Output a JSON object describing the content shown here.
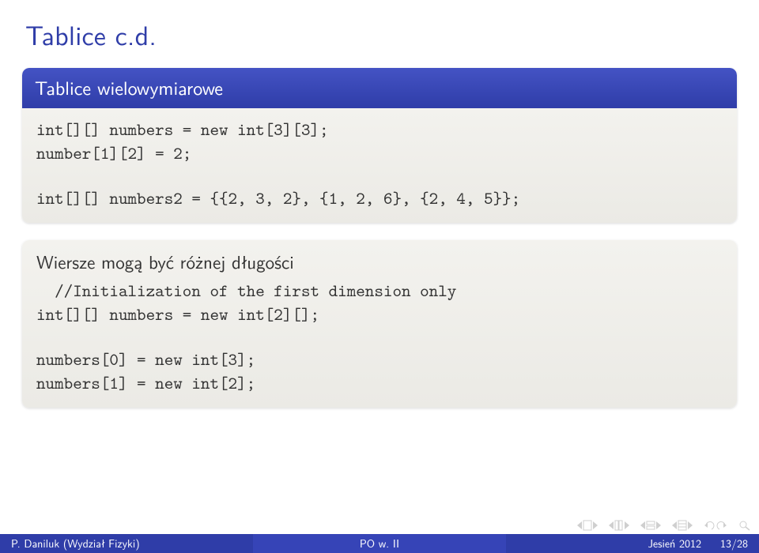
{
  "slide": {
    "title": "Tablice c.d."
  },
  "block1": {
    "title": "Tablice wielowymiarowe",
    "code_line1": "int[][] numbers = new int[3][3];",
    "code_line2": "number[1][2] = 2;",
    "code_line3": "int[][] numbers2 = {{2, 3, 2}, {1, 2, 6}, {2, 4, 5}};"
  },
  "block2": {
    "note": "Wiersze mogą być różnej długości",
    "code_line1": "  //Initialization of the first dimension only",
    "code_line2": "int[][] numbers = new int[2][];",
    "code_line3": "numbers[0] = new int[3];",
    "code_line4": "numbers[1] = new int[2];"
  },
  "footer": {
    "author": "P. Daniluk (Wydział Fizyki)",
    "title": "PO w. II",
    "date": "Jesień 2012",
    "page_current": "13",
    "page_sep": " / ",
    "page_total": "28"
  }
}
